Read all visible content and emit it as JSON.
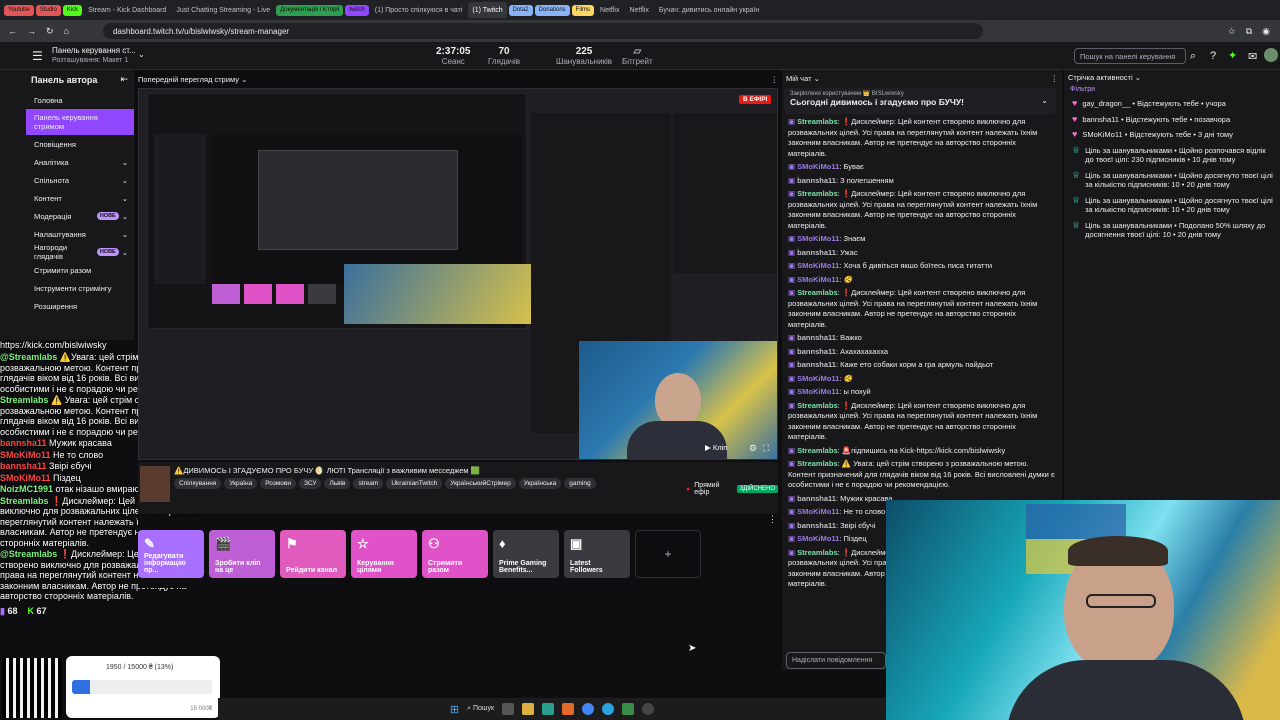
{
  "browser": {
    "tabs": [
      {
        "label": "Youtube",
        "chip": true,
        "color": "#e05555"
      },
      {
        "label": "Studio",
        "chip": true,
        "color": "#e05555"
      },
      {
        "label": "Kick",
        "chip": true,
        "color": "#53fc18"
      },
      {
        "label": "Stream - Kick Dashboard",
        "chip": false
      },
      {
        "label": "Just Chatting Streaming - Live",
        "chip": false
      },
      {
        "label": "Документація і історії",
        "chip": true,
        "color": "#2e9e4f"
      },
      {
        "label": "twitch",
        "chip": true,
        "color": "#9147ff"
      },
      {
        "label": "(1) Просто спілкуюся в чаті",
        "chip": false
      },
      {
        "label": "(1) Twitch",
        "chip": false,
        "active": true
      },
      {
        "label": "Dota2",
        "chip": true,
        "color": "#8ab4f8"
      },
      {
        "label": "Donations",
        "chip": true,
        "color": "#8ab4f8"
      },
      {
        "label": "Films",
        "chip": true,
        "color": "#fdd663"
      },
      {
        "label": "Netflix",
        "chip": false
      },
      {
        "label": "Netflix",
        "chip": false
      },
      {
        "label": "Бучач: дивитись онлайн україн",
        "chip": false
      }
    ],
    "url": "dashboard.twitch.tv/u/bislwiwsky/stream-manager"
  },
  "topbar": {
    "panel_title": "Панель керування ст...",
    "panel_subtitle": "Розташування: Макет 1",
    "session_value": "2:37:05",
    "session_label": "Сеанс",
    "viewers_value": "70",
    "viewers_label": "Глядачів",
    "followers_value": "225",
    "followers_label": "Шанувальників",
    "bits_label": "Бітгрейт",
    "search_placeholder": "Пошук на панелі керування"
  },
  "sidebar": {
    "title": "Панель автора",
    "items": [
      {
        "label": "Головна"
      },
      {
        "label": "Панель керування стримом",
        "active": true
      },
      {
        "label": "Сповіщення"
      },
      {
        "label": "Аналітика",
        "chevron": true
      },
      {
        "label": "Спільнота",
        "chevron": true
      },
      {
        "label": "Контент",
        "chevron": true
      },
      {
        "label": "Модерація",
        "badge": "НОВЕ",
        "chevron": true
      },
      {
        "label": "Налаштування",
        "chevron": true
      },
      {
        "label": "Нагороди глядачів",
        "badge": "НОВЕ",
        "chevron": true
      },
      {
        "label": "Стримити разом"
      },
      {
        "label": "Інструменти стримінгу"
      },
      {
        "label": "Розширення"
      }
    ]
  },
  "preview": {
    "label": "Попередній перегляд стриму",
    "live_badge": "В ЕФІРІ",
    "clip_label": "Кліп"
  },
  "overlay_chat": {
    "url": "https://kick.com/bislwiwsky",
    "messages": [
      {
        "user": "@Streamlabs",
        "cls": "n",
        "text": "⚠️Увага: цей стрім створено з розважальною метою. Контент призначений для глядачів віком від 16 років. Всі висловлені думки є особистими і не є порадою чи рекомендацією."
      },
      {
        "user": "Streamlabs",
        "cls": "n",
        "text": "⚠️ Увага: цей стрім створено з розважальною метою. Контент призначений для глядачів віком від 16 років. Всі висловлені думки є особистими і не є порадою чи рекомендацією."
      },
      {
        "user": "bannsha11",
        "cls": "r",
        "text": "Мужик красава"
      },
      {
        "user": "SMoKiMo11",
        "cls": "r",
        "text": "Не то слово"
      },
      {
        "user": "bannsha11",
        "cls": "r",
        "text": "Звірі єбучі"
      },
      {
        "user": "SMoKiMo11",
        "cls": "r",
        "text": "Піздец"
      },
      {
        "user": "NoizMC1991",
        "cls": "n",
        "text": "отак нізашо вмирають люди наші"
      },
      {
        "user": "Streamlabs",
        "cls": "n",
        "text": "❗Дисклеймер: Цей контент створено виключно для розважальних цілей. Усі права на переглянутий контент належать їхнім законним власникам. Автор не претендує на авторство сторонніх матеріалів."
      },
      {
        "user": "@Streamlabs",
        "cls": "n",
        "text": "❗Дисклеймер: Цей контент створено виключно для розважальних цілей. Усі права на переглянутий контент належать їхнім законним власникам. Автор не претендує на авторство сторонніх матеріалів."
      }
    ],
    "twitch_count": "68",
    "kick_count": "67"
  },
  "stream_info": {
    "title": "⚠️ДИВИМОСЬ І ЗГАДУЄМО ПРО БУЧУ 🌖 ЛЮТІ Трансляції з важливим месседжем 🟩",
    "tags": [
      "Спілкування",
      "Україна",
      "Розмови",
      "ЗСУ",
      "Львів",
      "stream",
      "UkrainianTwitch",
      "УкраїнськийСтрімер",
      "Українська",
      "gaming"
    ],
    "live_label": "Прямий ефір",
    "health_label": "ЗДІЙСНЕНО"
  },
  "quick_actions": [
    {
      "label": "Редагувати інформацію пр...",
      "icon": "✎",
      "color": "#a970ff"
    },
    {
      "label": "Зробити кліп на це",
      "icon": "🎬",
      "color": "#bf5fd6"
    },
    {
      "label": "Рейдити канал",
      "icon": "⚑",
      "color": "#e05bbd"
    },
    {
      "label": "Керування цілями",
      "icon": "☆",
      "color": "#e052c7"
    },
    {
      "label": "Стримити разом",
      "icon": "⚇",
      "color": "#e052c7"
    },
    {
      "label": "Prime Gaming Benefits...",
      "icon": "♦",
      "color": "#3a3a40"
    },
    {
      "label": "Latest Followers",
      "icon": "▣",
      "color": "#3a3a40"
    }
  ],
  "chat": {
    "title": "Мій чат",
    "pinned_by": "Закріплено користувачем 👑 BISLwiwsky",
    "pinned_text": "Сьогодні дивимось і згадуємо про БУЧУ!",
    "input_placeholder": "Надіслати повідомлення",
    "messages": [
      {
        "user": "Streamlabs",
        "ucls": "g",
        "text": "❗Дисклеймер: Цей контент створено виключно для розважальних цілей. Усі права на переглянутий контент належать їхнім законним власникам. Автор не претендує на авторство сторонніх матеріалів."
      },
      {
        "user": "SMoKiMo11",
        "ucls": "u",
        "text": "Буває"
      },
      {
        "user": "bannsha11",
        "ucls": "u2",
        "text": "З полегшенням"
      },
      {
        "user": "Streamlabs",
        "ucls": "g",
        "text": "❗Дисклеймер: Цей контент створено виключно для розважальних цілей. Усі права на переглянутий контент належать їхнім законним власникам. Автор не претендує на авторство сторонніх матеріалів."
      },
      {
        "user": "SMoKiMo11",
        "ucls": "u",
        "text": "Знаєм"
      },
      {
        "user": "bannsha11",
        "ucls": "u2",
        "text": "Ужас"
      },
      {
        "user": "SMoKiMo11",
        "ucls": "u",
        "text": "Хоча б дивіться якшо боїтесь писа титатти"
      },
      {
        "user": "SMoKiMo11",
        "ucls": "u",
        "text": "🫨"
      },
      {
        "user": "Streamlabs",
        "ucls": "g",
        "text": "❗Дисклеймер: Цей контент створено виключно для розважальних цілей. Усі права на переглянутий контент належать їхнім законним власникам. Автор не претендує на авторство сторонніх матеріалів."
      },
      {
        "user": "bannsha11",
        "ucls": "u2",
        "text": "Важко"
      },
      {
        "user": "bannsha11",
        "ucls": "u2",
        "text": "Ахахахахахха"
      },
      {
        "user": "bannsha11",
        "ucls": "u2",
        "text": "Каже ето собаки корм а гра армуль пайдьот"
      },
      {
        "user": "SMoKiMo11",
        "ucls": "u",
        "text": "🫨"
      },
      {
        "user": "SMoKiMo11",
        "ucls": "u",
        "text": "ы похуй"
      },
      {
        "user": "Streamlabs",
        "ucls": "g",
        "text": "❗Дисклеймер: Цей контент створено виключно для розважальних цілей. Усі права на переглянутий контент належать їхнім законним власникам. Автор не претендує на авторство сторонніх матеріалів."
      },
      {
        "user": "Streamlabs",
        "ucls": "g",
        "text": "🚨підпишись на Kick-https://kick.com/bislwiwsky"
      },
      {
        "user": "Streamlabs",
        "ucls": "g",
        "text": "⚠️ Увага: цей стрім створено з розважальною метою. Контент призначений для глядачів віком від 16 років. Всі висловлені думки є особистими і не є порадою чи рекомендацією."
      },
      {
        "user": "bannsha11",
        "ucls": "u2",
        "text": "Мужик красава"
      },
      {
        "user": "SMoKiMo11",
        "ucls": "u",
        "text": "Не то слово"
      },
      {
        "user": "bannsha11",
        "ucls": "u2",
        "text": "Звірі єбучі"
      },
      {
        "user": "SMoKiMo11",
        "ucls": "u",
        "text": "Піздец"
      },
      {
        "user": "Streamlabs",
        "ucls": "g",
        "text": "❗Дисклеймер: Цей контент створено виключно для розважальних цілей. Усі права на переглянутий контент належать їхнім законним власникам. Автор не претендує на авторство сторонніх матеріалів."
      }
    ]
  },
  "activity": {
    "title": "Стрічка активності",
    "filters_label": "Фільтри",
    "items": [
      {
        "icon": "heart",
        "text": "gay_dragon__ • Відстежують тебе • учора"
      },
      {
        "icon": "heart",
        "text": "bannsha11 • Відстежують тебе • позавчора"
      },
      {
        "icon": "heart",
        "text": "SMoKiMo11 • Відстежують тебе • 3 дні тому"
      },
      {
        "icon": "trophy",
        "text": "Ціль за шанувальниками • Щойно розпочався відлік до твоєї цілі: 230 підписників • 10 днів тому"
      },
      {
        "icon": "trophy",
        "text": "Ціль за шанувальниками • Щойно досягнуто твоєї цілі за кількістю підписників: 10 • 20 днів тому"
      },
      {
        "icon": "trophy",
        "text": "Ціль за шанувальниками • Щойно досягнуто твоєї цілі за кількістю підписників: 10 • 20 днів тому"
      },
      {
        "icon": "trophy",
        "text": "Ціль за шанувальниками • Подолано 50% шляху до досягнення твоєї цілі: 10 • 20 днів тому"
      }
    ]
  },
  "goal": {
    "text": "1950 / 15000 ₴ (13%)",
    "end": "15 000₴",
    "progress": 0.13
  },
  "taskbar": {
    "search_label": "Пошук"
  }
}
